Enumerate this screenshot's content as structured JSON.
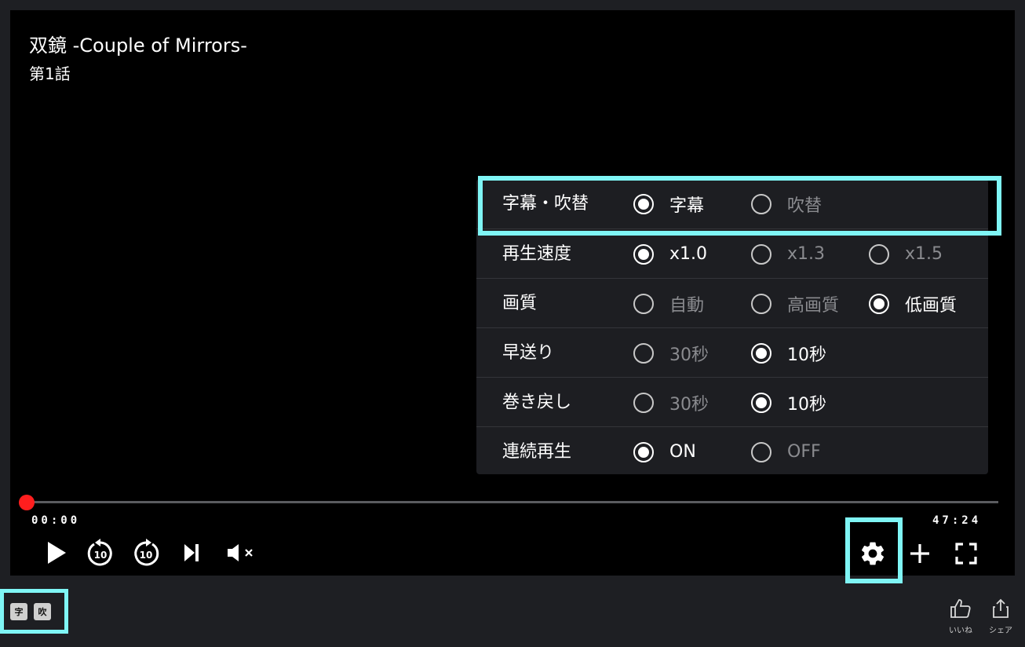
{
  "video": {
    "title": "双鏡 -Couple of Mirrors-",
    "episode": "第1話"
  },
  "settings": {
    "rows": [
      {
        "label": "字幕・吹替",
        "options": [
          {
            "label": "字幕",
            "selected": true
          },
          {
            "label": "吹替",
            "selected": false
          }
        ]
      },
      {
        "label": "再生速度",
        "options": [
          {
            "label": "x1.0",
            "selected": true
          },
          {
            "label": "x1.3",
            "selected": false
          },
          {
            "label": "x1.5",
            "selected": false
          }
        ]
      },
      {
        "label": "画質",
        "options": [
          {
            "label": "自動",
            "selected": false
          },
          {
            "label": "高画質",
            "selected": false
          },
          {
            "label": "低画質",
            "selected": true
          }
        ]
      },
      {
        "label": "早送り",
        "options": [
          {
            "label": "30秒",
            "selected": false
          },
          {
            "label": "10秒",
            "selected": true
          }
        ]
      },
      {
        "label": "巻き戻し",
        "options": [
          {
            "label": "30秒",
            "selected": false
          },
          {
            "label": "10秒",
            "selected": true
          }
        ]
      },
      {
        "label": "連続再生",
        "options": [
          {
            "label": "ON",
            "selected": true
          },
          {
            "label": "OFF",
            "selected": false
          }
        ]
      }
    ]
  },
  "progress": {
    "current": "00:00",
    "total": "47:24",
    "fraction": 0
  },
  "controls": {
    "rewind_seconds": "10",
    "forward_seconds": "10",
    "icons": [
      "play-icon",
      "rewind-10-icon",
      "forward-10-icon",
      "skip-next-icon",
      "mute-icon",
      "gear-icon",
      "plus-icon",
      "fullscreen-icon"
    ]
  },
  "badges": {
    "sub": "字",
    "dub": "吹"
  },
  "actions": {
    "like": "いいね",
    "share": "シェア"
  },
  "colors": {
    "highlight": "#7ff5f5",
    "progress_knob": "#ff1e1e",
    "panel_bg": "#1d1e22"
  }
}
